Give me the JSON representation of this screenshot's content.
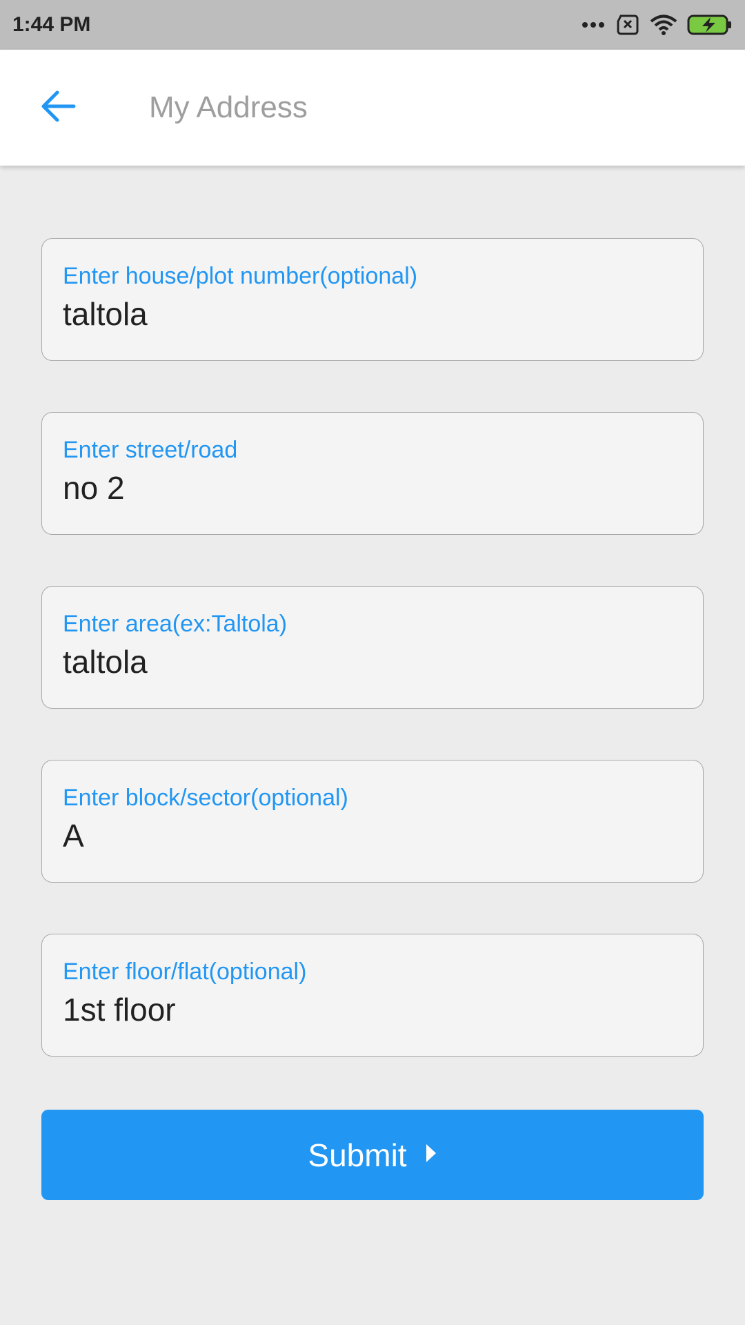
{
  "status_bar": {
    "time": "1:44 PM",
    "icons": [
      "more-dots-icon",
      "sim-error-icon",
      "wifi-icon",
      "battery-charging-icon"
    ]
  },
  "header": {
    "back_icon": "arrow-back-icon",
    "title": "My Address",
    "accent_color": "#2196f3"
  },
  "form": {
    "fields": [
      {
        "label": "Enter house/plot number(optional)",
        "value": "taltola"
      },
      {
        "label": "Enter street/road",
        "value": "no 2"
      },
      {
        "label": "Enter area(ex:Taltola)",
        "value": "taltola"
      },
      {
        "label": "Enter block/sector(optional)",
        "value": "A"
      },
      {
        "label": "Enter floor/flat(optional)",
        "value": "1st floor"
      }
    ]
  },
  "submit": {
    "label": "Submit",
    "icon": "caret-right-icon",
    "color": "#2196f3"
  }
}
